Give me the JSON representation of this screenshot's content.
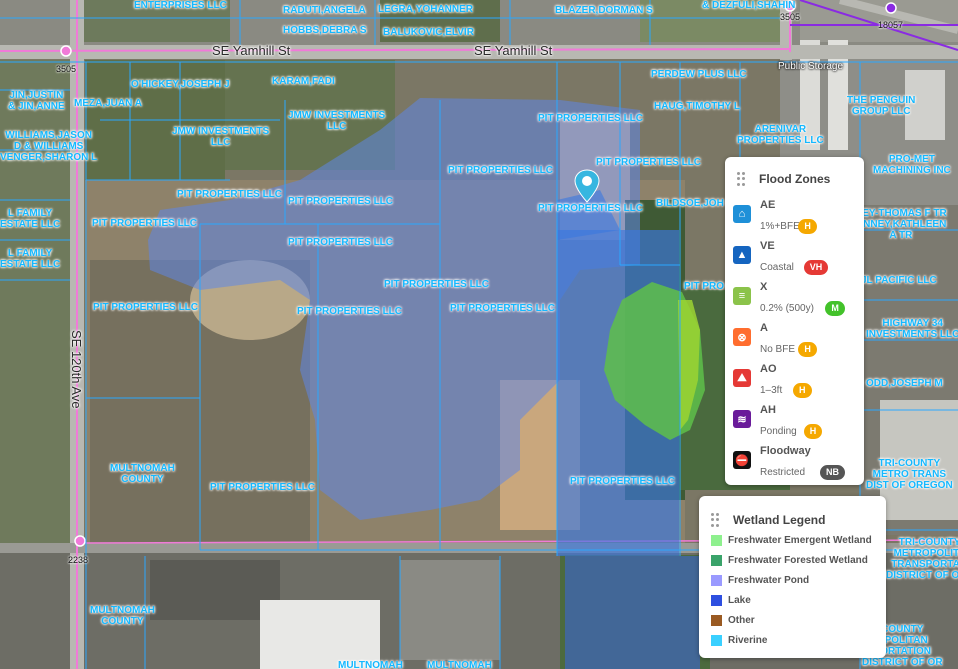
{
  "streets": {
    "yamhill_west": "SE Yamhill St",
    "yamhill_east": "SE Yamhill St",
    "ave_120th": "SE 120th Ave"
  },
  "address_labels": [
    "3505",
    "3505",
    "18057",
    "2238"
  ],
  "place_labels": [
    "Public Storage"
  ],
  "parcels": [
    "ENTERPRISES LLC",
    "RADUTI,ANGELA",
    "LEGRA,YOHANNER",
    "BLAZER,DORMAN S",
    "& DEZFULI,SHAHIN",
    "HOBBS,DEBRA S",
    "BALUKOVIC,ELVIR",
    "PERDEW PLUS LLC",
    "O'HICKEY,JOSEPH J",
    "KARAM,FADI",
    "JIN,JUSTIN\n& JIN,ANNE",
    "MEZA,JUAN A",
    "HAUG,TIMOTHY L",
    "THE PENGUIN\nGROUP LLC",
    "JMW INVESTMENTS\nLLC",
    "JMW INVESTMENTS\nLLC",
    "PIT PROPERTIES LLC",
    "WILLIAMS,JASON\nD & WILLIAMS\nVENGER,SHARON L",
    "ARENIVAR\nPROPERTIES LLC",
    "PRO-MET\nMACHINING INC",
    "PIT PROPERTIES LLC",
    "PIT PROPERTIES LLC",
    "PIT PROPERTIES LLC",
    "BILDSOE,JOH",
    "PIT PROPERTIES LLC",
    "PIT PROPERTIES LLC",
    "L FAMILY\nESTATE LLC",
    "PIT PROPERTIES LLC",
    "NEY-THOMAS F TR\nONNEY,KATHLEEN\nA TR",
    "PIT PROPERTIES LLC",
    "L FAMILY\nESTATE LLC",
    "PIT PROPERTIES LLC",
    "JL PACIFIC LLC",
    "PIT PRO",
    "PIT PROPERTIES LLC",
    "PIT PROPERTIES LLC",
    "PIT PROPERTIES LLC",
    "HIGHWAY 34\nINVESTMENTS LLC",
    "ODD,JOSEPH M",
    "MULTNOMAH\nCOUNTY",
    "PIT PROPERTIES LLC",
    "PIT PROPERTIES LLC",
    "TRI-COUNTY\nMETRO TRANS\nDIST OF OREGON",
    "TRI-COUNTY\nMETROPOLITA\nTRANSPORTATI\nDISTRICT OF ORE",
    "MULTNOMAH\nCOUNTY",
    "COUNTY\nOPOLITAN\nPORTATION\nDISTRICT OF OR",
    "MULTNOMAH",
    "MULTNOMAH"
  ],
  "flood_panel": {
    "title": "Flood Zones",
    "zones": [
      {
        "code": "AE",
        "desc": "1%+BFE",
        "badge": "H",
        "badge_color": "#f5a800",
        "icon": "wave-house-icon",
        "icon_color": "#1e90d8"
      },
      {
        "code": "VE",
        "desc": "Coastal",
        "badge": "VH",
        "badge_color": "#e53935",
        "icon": "warning-triangle-icon",
        "icon_color": "#1565c0"
      },
      {
        "code": "X",
        "desc": "0.2% (500y)",
        "badge": "M",
        "badge_color": "#43c22a",
        "icon": "lines-icon",
        "icon_color": "#8bc34a"
      },
      {
        "code": "A",
        "desc": "No BFE",
        "badge": "H",
        "badge_color": "#f5a800",
        "icon": "close-circle-icon",
        "icon_color": "#ff6d2e"
      },
      {
        "code": "AO",
        "desc": "1–3ft",
        "badge": "H",
        "badge_color": "#f5a800",
        "icon": "mountain-icon",
        "icon_color": "#e53935"
      },
      {
        "code": "AH",
        "desc": "Ponding",
        "badge": "H",
        "badge_color": "#f5a800",
        "icon": "waves-icon",
        "icon_color": "#6a1b9a"
      },
      {
        "code": "Floodway",
        "desc": "Restricted",
        "badge": "NB",
        "badge_color": "#555555",
        "icon": "restricted-icon",
        "icon_color": "#111111"
      }
    ]
  },
  "wetland_panel": {
    "title": "Wetland Legend",
    "items": [
      {
        "label": "Freshwater Emergent Wetland",
        "color": "#8ef08e"
      },
      {
        "label": "Freshwater Forested Wetland",
        "color": "#3aa36a"
      },
      {
        "label": "Freshwater Pond",
        "color": "#9a9aff"
      },
      {
        "label": "Lake",
        "color": "#2e4fe0"
      },
      {
        "label": "Other",
        "color": "#9a5a22"
      },
      {
        "label": "Riverine",
        "color": "#3ad0ff"
      }
    ]
  }
}
